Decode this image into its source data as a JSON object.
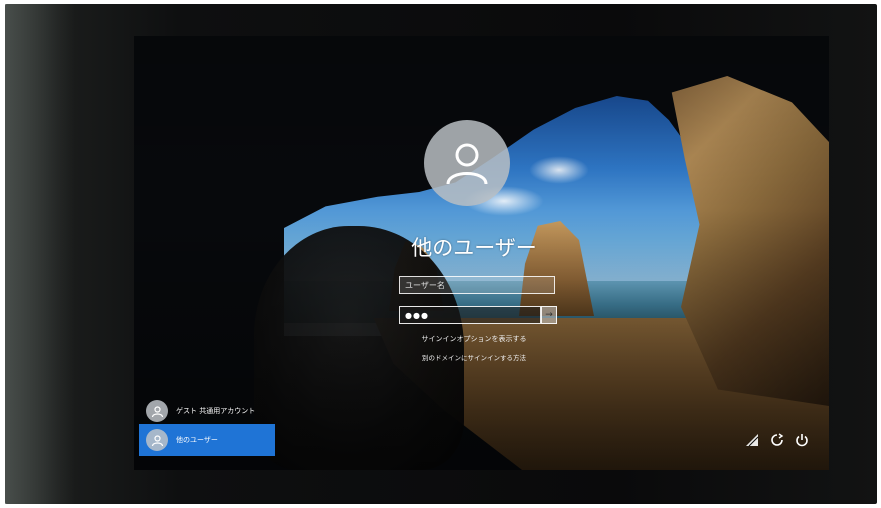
{
  "login": {
    "selected_user": "他のユーザー",
    "username_placeholder": "ユーザー名",
    "password_mask": "●●●",
    "submit_glyph": "→",
    "link_signin_method": "サインインオプションを表示する",
    "link_how_to_signin": "別のドメインにサインインする方法"
  },
  "users": [
    {
      "label": "ゲスト 共通用アカウント"
    },
    {
      "label": "他のユーザー"
    }
  ],
  "system": {
    "accessibility_icon": "ease-of-access-icon",
    "network_icon": "network-icon",
    "power_icon": "power-icon"
  },
  "colors": {
    "selected_tile": "#1f74d6",
    "avatar_bg": "#b9bec3"
  }
}
